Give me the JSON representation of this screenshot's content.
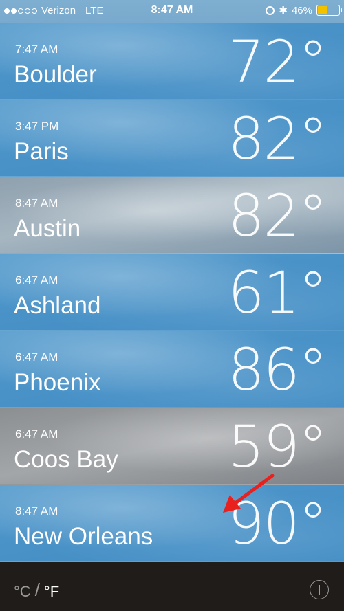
{
  "status_bar": {
    "carrier": "Verizon",
    "network": "LTE",
    "time": "8:47 AM",
    "battery_percent": "46%",
    "battery_level": 0.46,
    "signal_bars_filled": 2,
    "signal_bars_total": 5,
    "icons": [
      "alarm-icon",
      "bluetooth-icon",
      "battery-icon"
    ],
    "battery_color": "#f2c200"
  },
  "cities": [
    {
      "time": "7:47 AM",
      "name": "Boulder",
      "temp": "72°",
      "sky": "blue"
    },
    {
      "time": "3:47 PM",
      "name": "Paris",
      "temp": "82°",
      "sky": "blue"
    },
    {
      "time": "8:47 AM",
      "name": "Austin",
      "temp": "82°",
      "sky": "cloudy"
    },
    {
      "time": "6:47 AM",
      "name": "Ashland",
      "temp": "61°",
      "sky": "blue"
    },
    {
      "time": "6:47 AM",
      "name": "Phoenix",
      "temp": "86°",
      "sky": "blue"
    },
    {
      "time": "6:47 AM",
      "name": "Coos Bay",
      "temp": "59°",
      "sky": "grey"
    },
    {
      "time": "8:47 AM",
      "name": "New Orleans",
      "temp": "90°",
      "sky": "blue"
    }
  ],
  "annotation": {
    "icon": "red-arrow-icon",
    "color": "#e8211f"
  },
  "bottom_bar": {
    "unit_c": "°C",
    "unit_separator": "/",
    "unit_f": "°F",
    "add_icon": "plus-circle-icon"
  }
}
